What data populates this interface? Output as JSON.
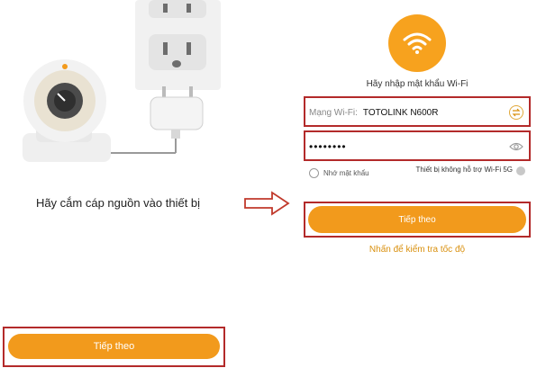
{
  "left_screen": {
    "instruction": "Hãy cắm cáp nguồn vào thiết bị",
    "next_button": "Tiếp theo"
  },
  "right_screen": {
    "prompt": "Hãy nhập mật khẩu Wi-Fi",
    "ssid_label": "Mạng Wi-Fi:",
    "ssid_value": "TOTOLINK N600R",
    "password_value": "••••••••",
    "remember_label": "Nhớ mật khẩu",
    "no_5g_label": "Thiết bị không hỗ trợ Wi-Fi 5G",
    "next_button": "Tiếp theo",
    "speed_test_link": "Nhấn để kiểm tra tốc độ"
  },
  "colors": {
    "accent": "#f29a1c",
    "highlight_frame": "#b32a2a",
    "link": "#d9900e"
  }
}
